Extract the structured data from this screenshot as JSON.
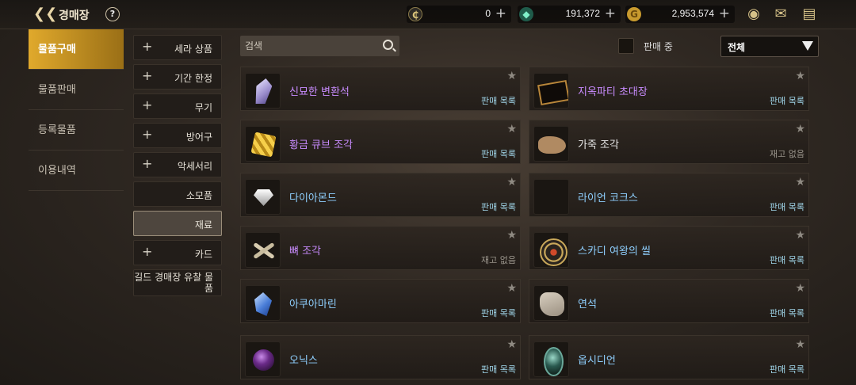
{
  "header": {
    "title": "경매장",
    "help_label": "?",
    "currencies": [
      {
        "icon": "c-coin-icon",
        "value": "0",
        "add": "+"
      },
      {
        "icon": "green-gem-icon",
        "value": "191,372",
        "add": "+"
      },
      {
        "icon": "gold-coin-icon",
        "value": "2,953,574",
        "add": "+"
      }
    ]
  },
  "left_nav": {
    "items": [
      {
        "label": "물품구매",
        "active": true
      },
      {
        "label": "물품판매",
        "active": false
      },
      {
        "label": "등록물품",
        "active": false
      },
      {
        "label": "이용내역",
        "active": false
      }
    ]
  },
  "categories": [
    {
      "label": "세라 상품",
      "plus": "+"
    },
    {
      "label": "기간 한정",
      "plus": "+"
    },
    {
      "label": "무기",
      "plus": "+"
    },
    {
      "label": "방어구",
      "plus": "+"
    },
    {
      "label": "악세서리",
      "plus": "+"
    },
    {
      "label": "소모품",
      "plus": ""
    },
    {
      "label": "재료",
      "plus": "",
      "active": true
    },
    {
      "label": "카드",
      "plus": "+"
    },
    {
      "label": "길드 경매장 유찰 물품",
      "plus": ""
    }
  ],
  "search": {
    "placeholder": "검색"
  },
  "filter": {
    "on_sale_label": "판매 중",
    "dropdown_value": "전체"
  },
  "items": [
    {
      "name": "신묘한 변환석",
      "status": "판매 목록",
      "name_color": "#c98cff",
      "thumb": "t-crystal"
    },
    {
      "name": "지옥파티 초대장",
      "status": "판매 목록",
      "name_color": "#c98cff",
      "thumb": "t-invite"
    },
    {
      "name": "황금 큐브 조각",
      "status": "판매 목록",
      "name_color": "#c98cff",
      "thumb": "t-gold"
    },
    {
      "name": "가죽 조각",
      "status": "재고 없음",
      "name_color": "#e8e8e8",
      "thumb": "t-leather"
    },
    {
      "name": "다이아몬드",
      "status": "판매 목록",
      "name_color": "#8fd0ff",
      "thumb": "t-diamond"
    },
    {
      "name": "라이언 코크스",
      "status": "판매 목록",
      "name_color": "#8fd0ff",
      "thumb": "t-cocos"
    },
    {
      "name": "뼈 조각",
      "status": "재고 없음",
      "name_color": "#c98cff",
      "thumb": "t-bone"
    },
    {
      "name": "스카디 여왕의 씰",
      "status": "판매 목록",
      "name_color": "#8fd0ff",
      "thumb": "t-seal"
    },
    {
      "name": "아쿠아마린",
      "status": "판매 목록",
      "name_color": "#8fd0ff",
      "thumb": "t-aqua"
    },
    {
      "name": "연석",
      "status": "판매 목록",
      "name_color": "#8fd0ff",
      "thumb": "t-stone"
    },
    {
      "name": "오닉스",
      "status": "판매 목록",
      "name_color": "#8fd0ff",
      "thumb": "t-onyx"
    },
    {
      "name": "옵시디언",
      "status": "판매 목록",
      "name_color": "#8fd0ff",
      "thumb": "t-obsidian"
    }
  ],
  "colors": {
    "accent": "#e0a92c",
    "sale_status": "#9fd4e8",
    "no_stock_status": "#9a958c"
  }
}
